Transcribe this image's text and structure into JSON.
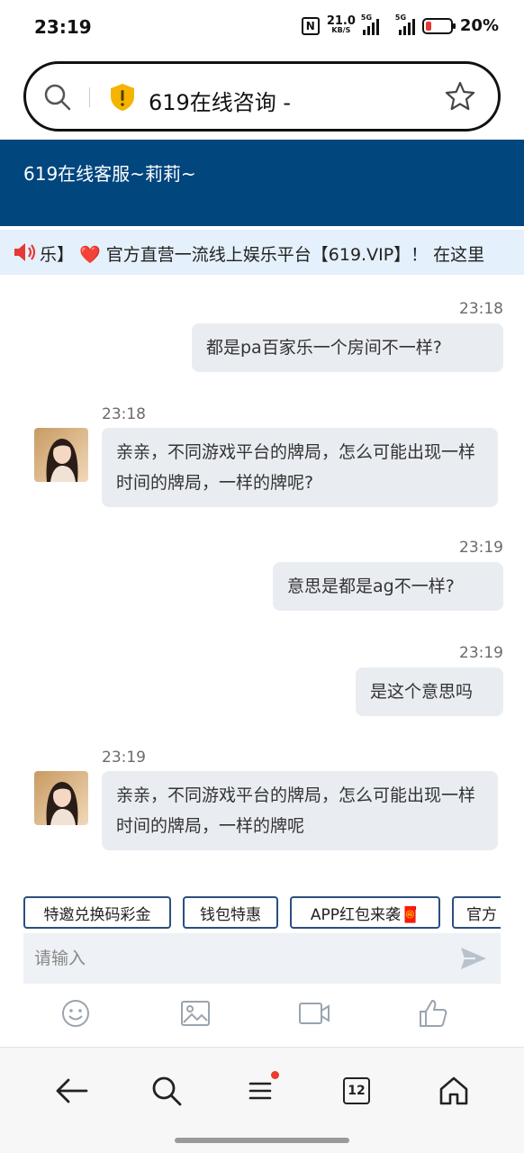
{
  "status_bar": {
    "time": "23:19",
    "net_speed": "21.0",
    "net_speed_unit": "KB/S",
    "signal1_label": "5G",
    "signal2_label": "5G",
    "battery": "20%",
    "battery_color": "#e53935",
    "nfc_label": "N"
  },
  "address_bar": {
    "title": "619在线咨询 -",
    "security_icon": "shield-icon",
    "search_icon": "search-icon",
    "bookmark_icon": "star-icon"
  },
  "header": {
    "title": "619在线客服~莉莉~",
    "background": "#02467e"
  },
  "marquee": {
    "prefix": "乐】",
    "text": "官方直营一流线上娱乐平台【619.VIP】！ 在这里"
  },
  "messages": [
    {
      "side": "right",
      "time": "23:18",
      "text": "都是pa百家乐一个房间不一样?"
    },
    {
      "side": "left",
      "time": "23:18",
      "text": "亲亲，不同游戏平台的牌局，怎么可能出现一样时间的牌局，一样的牌呢?"
    },
    {
      "side": "right",
      "time": "23:19",
      "text": "意思是都是ag不一样?"
    },
    {
      "side": "right",
      "time": "23:19",
      "text": "是这个意思吗"
    },
    {
      "side": "left",
      "time": "23:19",
      "text": "亲亲，不同游戏平台的牌局，怎么可能出现一样时间的牌局，一样的牌呢"
    }
  ],
  "quick_replies": [
    "特邀兑换码彩金",
    "钱包特惠",
    "APP红包来袭🧧",
    "官方"
  ],
  "input": {
    "placeholder": "请输入"
  },
  "toolbar": [
    "smile-icon",
    "image-icon",
    "video-icon",
    "thumbs-up-icon"
  ],
  "bottom_nav": {
    "tabs_count": "12",
    "items": [
      "back-arrow-icon",
      "search-icon",
      "menu-icon",
      "tabs-icon",
      "home-icon"
    ]
  }
}
